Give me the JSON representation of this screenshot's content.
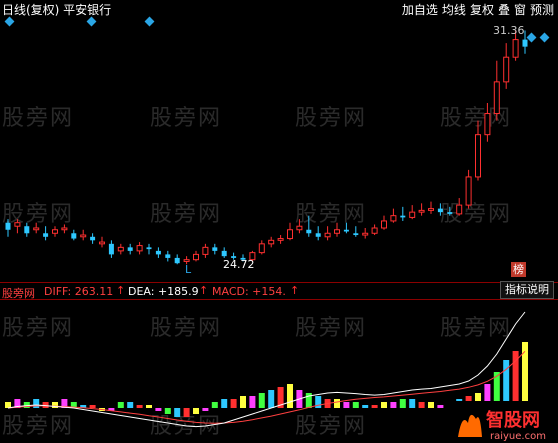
{
  "title": {
    "text": "日线(复权) 平安银行"
  },
  "toolbar": {
    "items": [
      "加自选",
      "均线",
      "复权",
      "叠",
      "窗",
      "预测"
    ]
  },
  "watermark": {
    "text": "股旁网"
  },
  "price_chart": {
    "high_label": "31.36",
    "low_label": "24.72",
    "low_marker": "L",
    "rank_badge": "榜",
    "up_color": "#ff3030",
    "down_color": "#2ec8ff"
  },
  "macd": {
    "source_label": "股旁网",
    "diff_label": "DIFF: 263.11",
    "dea_label": "DEA: +185.9",
    "macd_label": "MACD: +154.",
    "help_label": "指标说明"
  },
  "logo": {
    "brand": "智股网",
    "url": "raiyue.com"
  },
  "chart_data": {
    "type": "candlestick",
    "candles": [
      {
        "o": 25.9,
        "c": 25.7,
        "h": 26.0,
        "l": 25.5
      },
      {
        "o": 25.8,
        "c": 25.9,
        "h": 26.0,
        "l": 25.6
      },
      {
        "o": 25.8,
        "c": 25.6,
        "h": 25.9,
        "l": 25.5
      },
      {
        "o": 25.7,
        "c": 25.75,
        "h": 25.9,
        "l": 25.6
      },
      {
        "o": 25.6,
        "c": 25.5,
        "h": 25.8,
        "l": 25.4
      },
      {
        "o": 25.6,
        "c": 25.7,
        "h": 25.8,
        "l": 25.5
      },
      {
        "o": 25.7,
        "c": 25.75,
        "h": 25.85,
        "l": 25.6
      },
      {
        "o": 25.6,
        "c": 25.45,
        "h": 25.7,
        "l": 25.4
      },
      {
        "o": 25.5,
        "c": 25.55,
        "h": 25.7,
        "l": 25.4
      },
      {
        "o": 25.5,
        "c": 25.4,
        "h": 25.6,
        "l": 25.3
      },
      {
        "o": 25.3,
        "c": 25.35,
        "h": 25.5,
        "l": 25.2
      },
      {
        "o": 25.3,
        "c": 25.0,
        "h": 25.4,
        "l": 24.9
      },
      {
        "o": 25.1,
        "c": 25.2,
        "h": 25.3,
        "l": 25.0
      },
      {
        "o": 25.2,
        "c": 25.1,
        "h": 25.3,
        "l": 25.0
      },
      {
        "o": 25.1,
        "c": 25.25,
        "h": 25.35,
        "l": 25.0
      },
      {
        "o": 25.2,
        "c": 25.15,
        "h": 25.3,
        "l": 25.0
      },
      {
        "o": 25.1,
        "c": 25.0,
        "h": 25.2,
        "l": 24.9
      },
      {
        "o": 25.0,
        "c": 24.9,
        "h": 25.1,
        "l": 24.8
      },
      {
        "o": 24.9,
        "c": 24.75,
        "h": 25.0,
        "l": 24.72
      },
      {
        "o": 24.8,
        "c": 24.85,
        "h": 24.95,
        "l": 24.72
      },
      {
        "o": 24.85,
        "c": 25.0,
        "h": 25.1,
        "l": 24.8
      },
      {
        "o": 25.0,
        "c": 25.2,
        "h": 25.3,
        "l": 24.9
      },
      {
        "o": 25.2,
        "c": 25.1,
        "h": 25.3,
        "l": 25.0
      },
      {
        "o": 25.1,
        "c": 24.95,
        "h": 25.2,
        "l": 24.9
      },
      {
        "o": 24.95,
        "c": 24.9,
        "h": 25.05,
        "l": 24.85
      },
      {
        "o": 24.9,
        "c": 24.85,
        "h": 25.0,
        "l": 24.8
      },
      {
        "o": 24.85,
        "c": 25.05,
        "h": 25.1,
        "l": 24.8
      },
      {
        "o": 25.05,
        "c": 25.3,
        "h": 25.4,
        "l": 25.0
      },
      {
        "o": 25.3,
        "c": 25.4,
        "h": 25.5,
        "l": 25.2
      },
      {
        "o": 25.4,
        "c": 25.45,
        "h": 25.55,
        "l": 25.3
      },
      {
        "o": 25.45,
        "c": 25.7,
        "h": 25.9,
        "l": 25.4
      },
      {
        "o": 25.7,
        "c": 25.8,
        "h": 26.0,
        "l": 25.6
      },
      {
        "o": 25.7,
        "c": 25.6,
        "h": 26.1,
        "l": 25.5
      },
      {
        "o": 25.6,
        "c": 25.5,
        "h": 25.8,
        "l": 25.4
      },
      {
        "o": 25.5,
        "c": 25.6,
        "h": 25.8,
        "l": 25.4
      },
      {
        "o": 25.6,
        "c": 25.7,
        "h": 25.9,
        "l": 25.5
      },
      {
        "o": 25.7,
        "c": 25.65,
        "h": 25.9,
        "l": 25.6
      },
      {
        "o": 25.6,
        "c": 25.55,
        "h": 25.8,
        "l": 25.5
      },
      {
        "o": 25.55,
        "c": 25.6,
        "h": 25.75,
        "l": 25.45
      },
      {
        "o": 25.6,
        "c": 25.75,
        "h": 25.85,
        "l": 25.55
      },
      {
        "o": 25.75,
        "c": 25.95,
        "h": 26.1,
        "l": 25.7
      },
      {
        "o": 25.95,
        "c": 26.1,
        "h": 26.3,
        "l": 25.9
      },
      {
        "o": 26.1,
        "c": 26.05,
        "h": 26.35,
        "l": 25.95
      },
      {
        "o": 26.05,
        "c": 26.2,
        "h": 26.4,
        "l": 26.0
      },
      {
        "o": 26.2,
        "c": 26.25,
        "h": 26.45,
        "l": 26.1
      },
      {
        "o": 26.25,
        "c": 26.3,
        "h": 26.5,
        "l": 26.15
      },
      {
        "o": 26.3,
        "c": 26.2,
        "h": 26.45,
        "l": 26.1
      },
      {
        "o": 26.2,
        "c": 26.15,
        "h": 26.35,
        "l": 26.1
      },
      {
        "o": 26.15,
        "c": 26.4,
        "h": 26.6,
        "l": 26.1
      },
      {
        "o": 26.4,
        "c": 27.2,
        "h": 27.4,
        "l": 26.3
      },
      {
        "o": 27.2,
        "c": 28.4,
        "h": 28.8,
        "l": 27.1
      },
      {
        "o": 28.4,
        "c": 29.0,
        "h": 29.3,
        "l": 28.2
      },
      {
        "o": 29.0,
        "c": 29.9,
        "h": 30.5,
        "l": 28.8
      },
      {
        "o": 29.9,
        "c": 30.6,
        "h": 31.0,
        "l": 29.7
      },
      {
        "o": 30.6,
        "c": 31.1,
        "h": 31.36,
        "l": 30.5
      },
      {
        "o": 31.1,
        "c": 30.9,
        "h": 31.36,
        "l": 30.7
      }
    ],
    "ylim": [
      24.5,
      31.6
    ],
    "macd_hist": [
      2,
      3,
      2,
      3,
      2,
      2,
      3,
      2,
      1,
      1,
      -1,
      -1,
      2,
      2,
      1,
      1,
      -1,
      -2,
      -3,
      -3,
      -2,
      -1,
      2,
      3,
      3,
      4,
      4,
      5,
      6,
      7,
      8,
      6,
      5,
      4,
      3,
      3,
      2,
      2,
      1,
      1,
      2,
      2,
      3,
      3,
      2,
      2,
      1,
      2,
      3,
      4,
      5,
      8,
      12,
      16,
      19,
      22
    ],
    "diff_line": [
      0,
      0.5,
      0.8,
      1,
      0.8,
      0.5,
      0.3,
      0,
      -0.5,
      -1,
      -1.5,
      -2,
      -2.5,
      -3,
      -3.5,
      -4,
      -4.5,
      -5,
      -5.5,
      -6,
      -6.2,
      -6,
      -5.5,
      -5,
      -4,
      -3,
      -2,
      -1,
      0,
      1,
      2,
      3,
      4,
      4.5,
      5,
      5.2,
      5,
      4.8,
      4.5,
      4.3,
      4.5,
      5,
      5.5,
      6,
      6.3,
      6.5,
      7,
      7.5,
      8,
      9,
      11,
      14,
      18,
      23,
      28,
      32
    ],
    "dea_line": [
      0,
      0.3,
      0.5,
      0.7,
      0.7,
      0.6,
      0.5,
      0.3,
      0.1,
      -0.2,
      -0.5,
      -0.9,
      -1.3,
      -1.7,
      -2.1,
      -2.6,
      -3,
      -3.5,
      -4,
      -4.4,
      -4.8,
      -5,
      -5.1,
      -5,
      -4.8,
      -4.4,
      -3.9,
      -3.3,
      -2.7,
      -2,
      -1.3,
      -0.6,
      0.2,
      0.9,
      1.5,
      2,
      2.5,
      2.9,
      3.2,
      3.5,
      3.7,
      4,
      4.3,
      4.6,
      4.9,
      5.2,
      5.5,
      5.9,
      6.3,
      6.9,
      7.7,
      8.9,
      10.6,
      12.9,
      15.7,
      18.9
    ],
    "hist_colors": [
      "#ffff40",
      "#ff40ff",
      "#40ff40",
      "#2ec8ff",
      "#ff3030"
    ]
  }
}
